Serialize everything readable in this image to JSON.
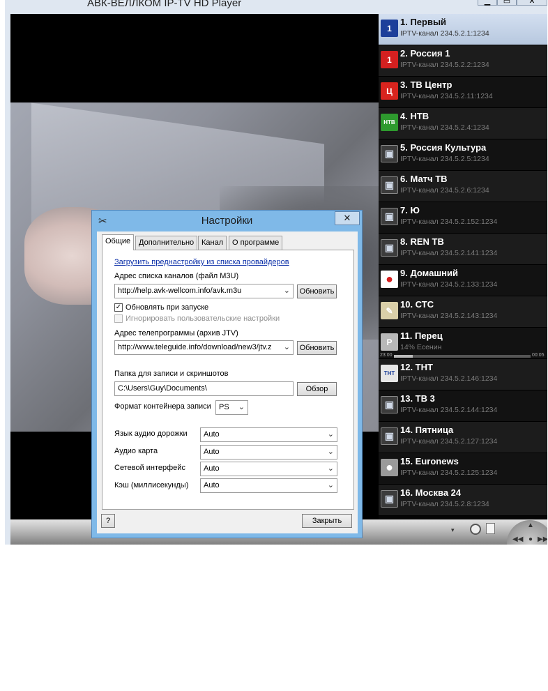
{
  "window": {
    "title": "АВК-ВЕЛЛКОМ IP-TV HD Player",
    "buttons": {
      "minimize": "▁",
      "maximize": "▭",
      "close": "✕"
    }
  },
  "channels": [
    {
      "name": "1. Первый",
      "sub": "IPTV-канал 234.5.2.1:1234",
      "logo": "channel-one-logo",
      "logo_text": "1",
      "logo_color": "#1d3f9a",
      "selected": true
    },
    {
      "name": "2. Россия 1",
      "sub": "IPTV-канал 234.5.2.2:1234",
      "logo": "russia-one-logo",
      "logo_text": "1",
      "logo_color": "#d42020"
    },
    {
      "name": "3. ТВ Центр",
      "sub": "IPTV-канал 234.5.2.11:1234",
      "logo": "tv-center-logo",
      "logo_text": "Ц",
      "logo_color": "#d8241e"
    },
    {
      "name": "4. НТВ",
      "sub": "IPTV-канал 234.5.2.4:1234",
      "logo": "ntv-logo",
      "logo_text": "НТВ",
      "logo_color": "#2e9a2e"
    },
    {
      "name": "5. Россия Культура",
      "sub": "IPTV-канал 234.5.2.5:1234",
      "logo": "tv-icon",
      "logo_text": "▣",
      "logo_color": "#3c3c3c"
    },
    {
      "name": "6. Матч ТВ",
      "sub": "IPTV-канал 234.5.2.6:1234",
      "logo": "tv-icon",
      "logo_text": "▣",
      "logo_color": "#3c3c3c"
    },
    {
      "name": "7. Ю",
      "sub": "IPTV-канал 234.5.2.152:1234",
      "logo": "tv-icon",
      "logo_text": "▣",
      "logo_color": "#3c3c3c"
    },
    {
      "name": "8. REN TB",
      "sub": "IPTV-канал 234.5.2.141:1234",
      "logo": "tv-icon",
      "logo_text": "▣",
      "logo_color": "#3c3c3c"
    },
    {
      "name": "9. Домашний",
      "sub": "IPTV-канал 234.5.2.133:1234",
      "logo": "domashny-logo",
      "logo_text": "●",
      "logo_color": "#f2b400"
    },
    {
      "name": "10. СТС",
      "sub": "IPTV-канал 234.5.2.143:1234",
      "logo": "sts-logo",
      "logo_text": "✎",
      "logo_color": "#d9cfa8"
    },
    {
      "name": "11. Перец",
      "sub": "14% Есенин",
      "logo": "perets-logo",
      "logo_text": "Р",
      "logo_color": "#b8b8b8",
      "progress": {
        "start": "23:00",
        "end": "00:05",
        "percent": 14
      }
    },
    {
      "name": "12. ТНТ",
      "sub": "IPTV-канал 234.5.2.146:1234",
      "logo": "tnt-logo",
      "logo_text": "ТНТ",
      "logo_color": "#e6e6e6"
    },
    {
      "name": "13. ТВ 3",
      "sub": "IPTV-канал 234.5.2.144:1234",
      "logo": "tv-icon",
      "logo_text": "▣",
      "logo_color": "#3c3c3c"
    },
    {
      "name": "14. Пятница",
      "sub": "IPTV-канал 234.5.2.127:1234",
      "logo": "tv-icon",
      "logo_text": "▣",
      "logo_color": "#3c3c3c"
    },
    {
      "name": "15. Euronews",
      "sub": "IPTV-канал 234.5.2.125:1234",
      "logo": "euronews-logo",
      "logo_text": "●",
      "logo_color": "#9a9a9a"
    },
    {
      "name": "16. Москва 24",
      "sub": "IPTV-канал 234.5.2.8:1234",
      "logo": "tv-icon",
      "logo_text": "▣",
      "logo_color": "#3c3c3c"
    }
  ],
  "dialog": {
    "title": "Настройки",
    "close": "✕",
    "tabs": [
      "Общие",
      "Дополнительно",
      "Канал",
      "О программе"
    ],
    "active_tab": "Общие",
    "load_preset_link": "Загрузить преднастройку из списка провайдеров",
    "playlist_label": "Адрес списка каналов (файл M3U)",
    "playlist_value": "http://help.avk-wellcom.info/avk.m3u",
    "update_button": "Обновить",
    "update_on_start_label": "Обновлять при запуске",
    "update_on_start_checked": true,
    "ignore_user_settings_label": "Игнорировать пользовательские настройки",
    "ignore_user_settings_checked": false,
    "epg_label": "Адрес телепрограммы (архив JTV)",
    "epg_value": "http://www.teleguide.info/download/new3/jtv.z",
    "epg_update_button": "Обновить",
    "record_folder_label": "Папка для записи и скриншотов",
    "record_folder_value": "C:\\Users\\Guy\\Documents\\",
    "browse_button": "Обзор",
    "container_label": "Формат контейнера записи",
    "container_value": "PS",
    "audio_track_label": "Язык аудио дорожки",
    "audio_track_value": "Auto",
    "audio_card_label": "Аудио карта",
    "audio_card_value": "Auto",
    "network_label": "Сетевой интерфейс",
    "network_value": "Auto",
    "cache_label": "Кэш (миллисекунды)",
    "cache_value": "Auto",
    "help_button": "?",
    "close_button": "Закрыть"
  },
  "controls": {
    "dropdown_glyph": "▾",
    "nav_icons": [
      "up-arrow-icon",
      "rewind-icon",
      "forward-icon"
    ]
  }
}
